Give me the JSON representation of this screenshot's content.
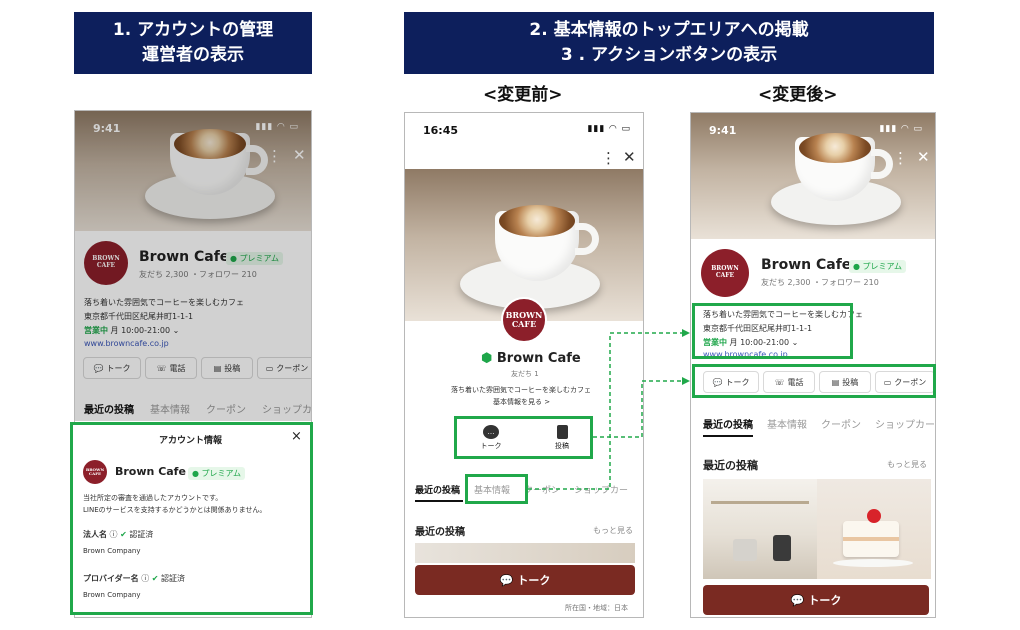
{
  "banners": {
    "left_line1": "1. アカウントの管理",
    "left_line2": "運営者の表示",
    "right_line1": "2. 基本情報のトップエリアへの掲載",
    "right_line2": "3 . アクションボタンの表示"
  },
  "labels": {
    "before": "<変更前>",
    "after": "<変更後>"
  },
  "account": {
    "name": "Brown Cafe",
    "avatar_line1": "BROWN",
    "avatar_line2": "CAFE",
    "premium": "プレミアム",
    "friends_followers": "友だち 2,300 ・フォロワー 210",
    "description": "落ち着いた雰囲気でコーヒーを楽しむカフェ",
    "address": "東京都千代田区紀尾井町1-1-1",
    "open_status": "営業中",
    "hours": "月 10:00-21:00",
    "website": "www.browncafe.co.jp"
  },
  "phone_left": {
    "time": "9:41",
    "actions": [
      "トーク",
      "電話",
      "投稿",
      "クーポン"
    ],
    "tabs": [
      "最近の投稿",
      "基本情報",
      "クーポン",
      "ショップカー"
    ]
  },
  "account_panel": {
    "title": "アカウント情報",
    "close": "×",
    "desc_line1": "当社所定の審査を通過したアカウントです。",
    "desc_line2": "LINEのサービスを支持するかどうかとは関係ありません。",
    "corp_label": "法人名",
    "corp_status": "認証済",
    "corp_value": "Brown Company",
    "provider_label": "プロバイダー名",
    "provider_status": "認証済",
    "provider_value": "Brown Company"
  },
  "phone_before": {
    "time": "16:45",
    "name": "Brown Cafe",
    "friends": "友だち 1",
    "description": "落ち着いた雰囲気でコーヒーを楽しむカフェ",
    "basic_info_link": "基本情報を見る >",
    "buttons": [
      "トーク",
      "投稿"
    ],
    "tabs": [
      "最近の投稿",
      "基本情報",
      "クーポン",
      "ショップカー"
    ],
    "recent_posts": "最近の投稿",
    "more": "もっと見る",
    "talk_button": "トーク",
    "footer": "所在国・地域：日本"
  },
  "phone_after": {
    "time": "9:41",
    "actions": [
      "トーク",
      "電話",
      "投稿",
      "クーポン"
    ],
    "tabs": [
      "最近の投稿",
      "基本情報",
      "クーポン",
      "ショップカー"
    ],
    "recent_posts": "最近の投稿",
    "more": "もっと見る",
    "talk_button": "トーク"
  },
  "colors": {
    "banner": "#0d1f5c",
    "highlight": "#20a84a",
    "talk_button": "#7a2a22",
    "avatar": "#8c1f2a"
  }
}
